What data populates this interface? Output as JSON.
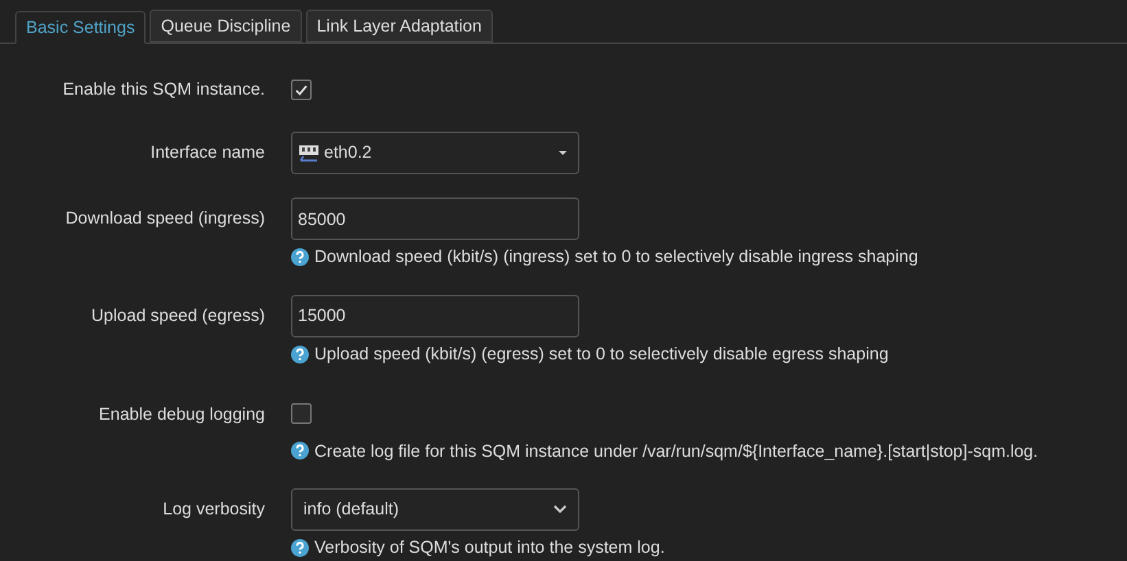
{
  "tabs": [
    {
      "label": "Basic Settings",
      "selected": true
    },
    {
      "label": "Queue Discipline",
      "selected": false
    },
    {
      "label": "Link Layer Adaptation",
      "selected": false
    }
  ],
  "fields": [
    {
      "kind": "checkbox",
      "label": "Enable this SQM instance.",
      "checked": true
    },
    {
      "kind": "dropdown",
      "label": "Interface name",
      "value": "eth0.2"
    },
    {
      "kind": "text",
      "label": "Download speed (ingress)",
      "value": "85000",
      "help": "Download speed (kbit/s) (ingress) set to 0 to selectively disable ingress shaping"
    },
    {
      "kind": "text",
      "label": "Upload speed (egress)",
      "value": "15000",
      "help": "Upload speed (kbit/s) (egress) set to 0 to selectively disable egress shaping"
    },
    {
      "kind": "checkbox",
      "label": "Enable debug logging",
      "checked": false,
      "help": "Create log file for this SQM instance under /var/run/sqm/${Interface_name}.[start|stop]-sqm.log."
    },
    {
      "kind": "select",
      "label": "Log verbosity",
      "value": "info (default)",
      "help": "Verbosity of SQM's output into the system log."
    }
  ]
}
